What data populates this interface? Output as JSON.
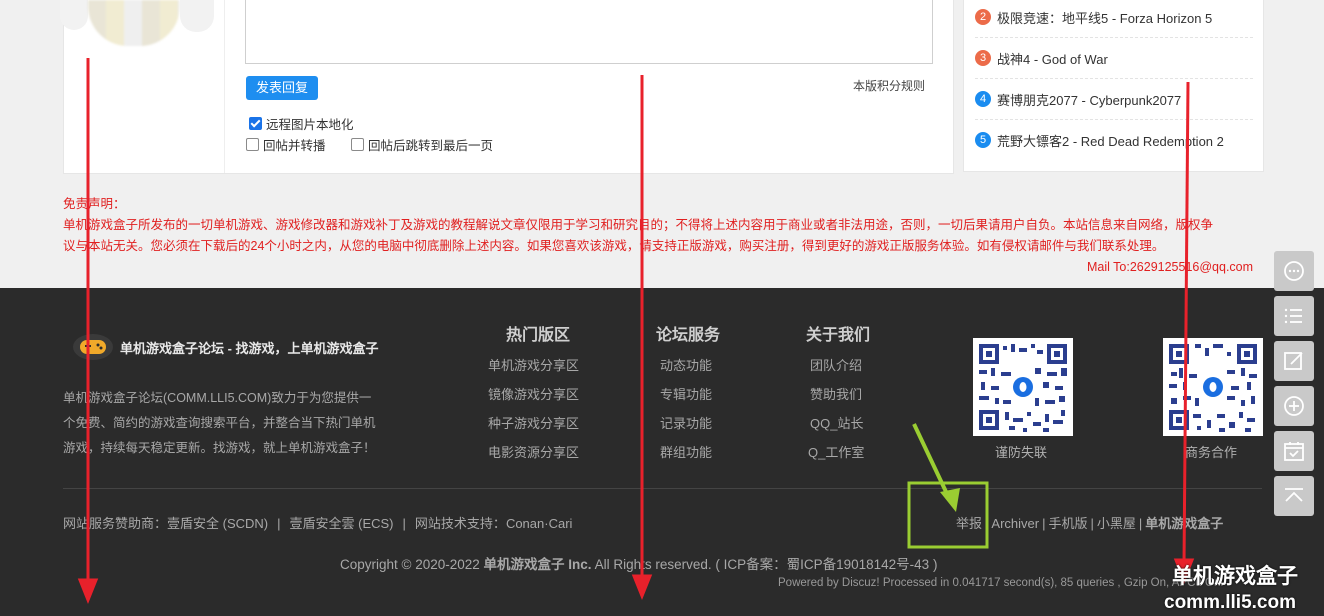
{
  "reply": {
    "submit_label": "发表回复",
    "rules_link": "本版积分规则",
    "options": [
      {
        "label": "远程图片本地化",
        "checked": true
      },
      {
        "label": "回帖并转播",
        "checked": false
      },
      {
        "label": "回帖后跳转到最后一页",
        "checked": false
      }
    ]
  },
  "ranking": {
    "items": [
      {
        "num": "2",
        "title": "极限竞速：地平线5 - Forza Horizon 5",
        "color": "#ec6b49"
      },
      {
        "num": "3",
        "title": "战神4 - God of War",
        "color": "#ec6b49"
      },
      {
        "num": "4",
        "title": "赛博朋克2077 - Cyberpunk2077",
        "color": "#1a8cf0"
      },
      {
        "num": "5",
        "title": "荒野大镖客2 - Red Dead Redemption 2",
        "color": "#1a8cf0"
      }
    ]
  },
  "disclaimer": {
    "title": "免责声明：",
    "line1": "单机游戏盒子所发布的一切单机游戏、游戏修改器和游戏补丁及游戏的教程解说文章仅限用于学习和研究目的；不得将上述内容用于商业或者非法用途，否则，一切后果请用户自负。本站信息来自网络，版权争",
    "line2": "议与本站无关。您必须在下载后的24个小时之内，从您的电脑中彻底删除上述内容。如果您喜欢该游戏，请支持正版游戏，购买注册，得到更好的游戏正版服务体验。如有侵权请邮件与我们联系处理。",
    "mail": "Mail To:2629125516@qq.com"
  },
  "footer": {
    "site_title": "单机游戏盒子论坛 - 找游戏，上单机游戏盒子",
    "desc1": "单机游戏盒子论坛(COMM.LLI5.COM)致力于为您提供一",
    "desc2": "个免费、简约的游戏查询搜索平台，并整合当下热门单机",
    "desc3": "游戏，持续每天稳定更新。找游戏，就上单机游戏盒子！",
    "columns": [
      {
        "heading": "热门版区",
        "items": [
          "单机游戏分享区",
          "镜像游戏分享区",
          "种子游戏分享区",
          "电影资源分享区"
        ]
      },
      {
        "heading": "论坛服务",
        "items": [
          "动态功能",
          "专辑功能",
          "记录功能",
          "群组功能"
        ]
      },
      {
        "heading": "关于我们",
        "items": [
          "团队介绍",
          "赞助我们",
          "QQ_站长",
          "Q_工作室"
        ]
      }
    ],
    "qr_captions": [
      "谨防失联",
      "商务合作"
    ],
    "sponsor_prefix": "网站服务赞助商：",
    "sponsor1": "壹盾安全 (SCDN)",
    "sponsor2": "壹盾安全雲 (ECS)",
    "tech_prefix": "网站技术支持：",
    "tech": "Conan·Cari",
    "links": [
      "举报",
      "Archiver",
      "手机版",
      "小黑屋",
      "单机游戏盒子"
    ],
    "copyright_pre": "Copyright © 2020-2022 ",
    "copyright_brand": "单机游戏盒子 Inc.",
    "copyright_post": " All Rights reserved. ( ICP备案：蜀ICP备19018142号-43 )",
    "powered": "Powered by Discuz! Processed in 0.041717 second(s), 85 queries , Gzip On, APCu On.",
    "watermark_cn": "单机游戏盒子",
    "watermark_url": "comm.lli5.com"
  },
  "colors": {
    "accent": "#1e8ef0",
    "annotation_red": "#e8212b",
    "annotation_green": "#9acd32"
  }
}
